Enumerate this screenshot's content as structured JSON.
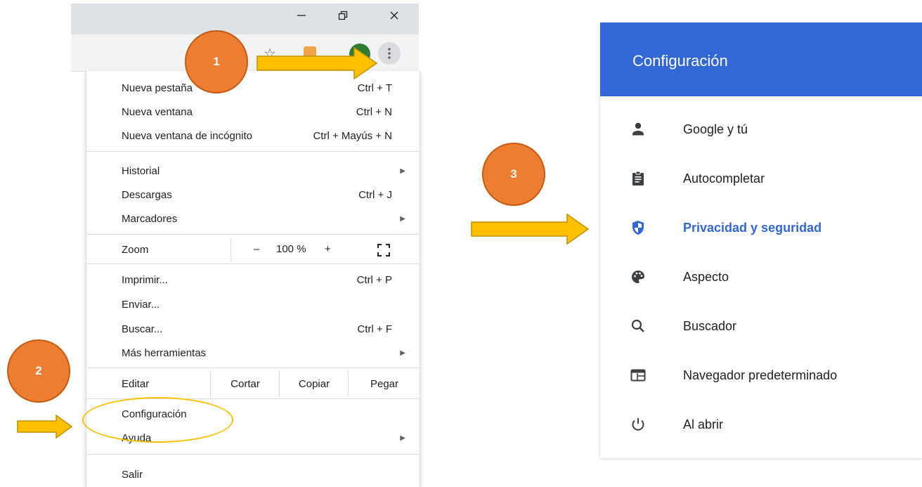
{
  "window_controls": [
    "—",
    "❐",
    "✕"
  ],
  "toolbar": {
    "menu_icon": "more-vert-icon",
    "bookmark_icon": "star-icon"
  },
  "chrome_menu": {
    "group1": [
      {
        "label": "Nueva pestaña",
        "shortcut": "Ctrl + T"
      },
      {
        "label": "Nueva ventana",
        "shortcut": "Ctrl + N"
      },
      {
        "label": "Nueva ventana de incógnito",
        "shortcut": "Ctrl + Mayús + N"
      }
    ],
    "group2": [
      {
        "label": "Historial",
        "shortcut": "",
        "submenu": true
      },
      {
        "label": "Descargas",
        "shortcut": "Ctrl + J"
      },
      {
        "label": "Marcadores",
        "shortcut": "",
        "submenu": true
      }
    ],
    "zoom": {
      "label": "Zoom",
      "minus": "–",
      "value": "100 %",
      "plus": "+"
    },
    "group3": [
      {
        "label": "Imprimir...",
        "shortcut": "Ctrl + P"
      },
      {
        "label": "Enviar...",
        "shortcut": ""
      },
      {
        "label": "Buscar...",
        "shortcut": "Ctrl + F"
      },
      {
        "label": "Más herramientas",
        "shortcut": "",
        "submenu": true
      }
    ],
    "edit": {
      "label": "Editar",
      "cut": "Cortar",
      "copy": "Copiar",
      "paste": "Pegar"
    },
    "group4": [
      {
        "label": "Configuración",
        "shortcut": ""
      },
      {
        "label": "Ayuda",
        "shortcut": "",
        "submenu": true
      }
    ],
    "exit": {
      "label": "Salir"
    }
  },
  "annotations": {
    "step1": "1",
    "step2": "2",
    "step3": "3",
    "arrow_color": "#ffc000",
    "badge_color": "#ed7d31"
  },
  "settings": {
    "title": "Configuración",
    "header_color": "#3367d6",
    "items": [
      {
        "label": "Google y tú",
        "icon": "person-icon"
      },
      {
        "label": "Autocompletar",
        "icon": "clipboard-icon"
      },
      {
        "label": "Privacidad y seguridad",
        "icon": "shield-icon",
        "active": true
      },
      {
        "label": "Aspecto",
        "icon": "palette-icon"
      },
      {
        "label": "Buscador",
        "icon": "search-icon"
      },
      {
        "label": "Navegador predeterminado",
        "icon": "browser-window-icon"
      },
      {
        "label": "Al abrir",
        "icon": "power-icon"
      }
    ]
  }
}
